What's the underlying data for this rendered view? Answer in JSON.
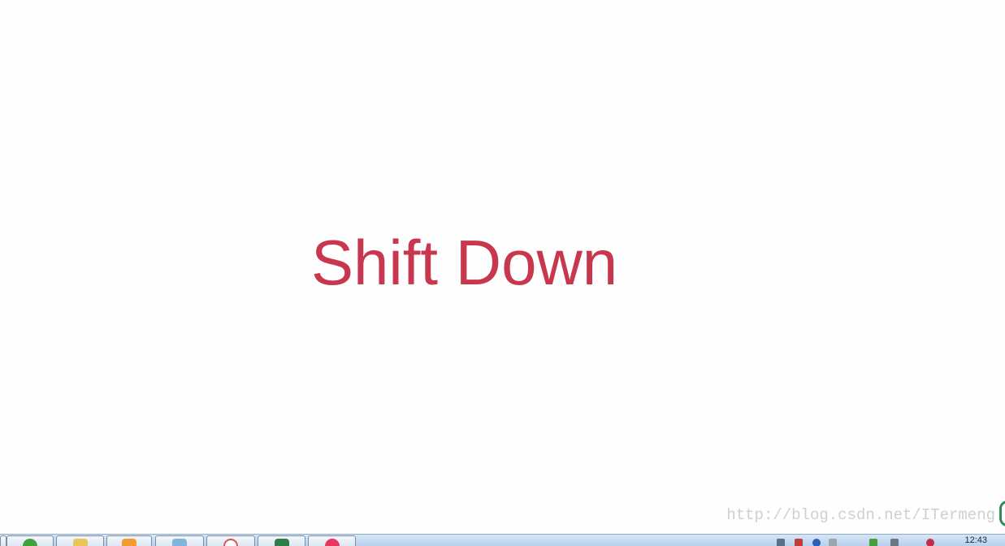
{
  "slide": {
    "headline": "Shift Down",
    "headline_color": "#c8374e"
  },
  "watermark": {
    "text": "http://blog.csdn.net/ITermeng"
  },
  "taskbar": {
    "buttons": [
      {
        "icon": "browser-icon",
        "color": "#3ea33a"
      },
      {
        "icon": "folder-icon",
        "color": "#e7c55a"
      },
      {
        "icon": "app-orange-icon",
        "color": "#f29b2f"
      },
      {
        "icon": "notepad-icon",
        "color": "#7fb6d9"
      },
      {
        "icon": "prohibited-app-icon",
        "color": "#d9534f"
      },
      {
        "icon": "terminal-app-icon",
        "color": "#2f7d4d"
      },
      {
        "icon": "music-app-icon",
        "color": "#e8365d"
      }
    ],
    "tray_icons": [
      "language-icon",
      "network-icon",
      "volume-icon",
      "monitor-icon",
      "security-icon",
      "flag-icon"
    ],
    "clock": "12:43"
  }
}
